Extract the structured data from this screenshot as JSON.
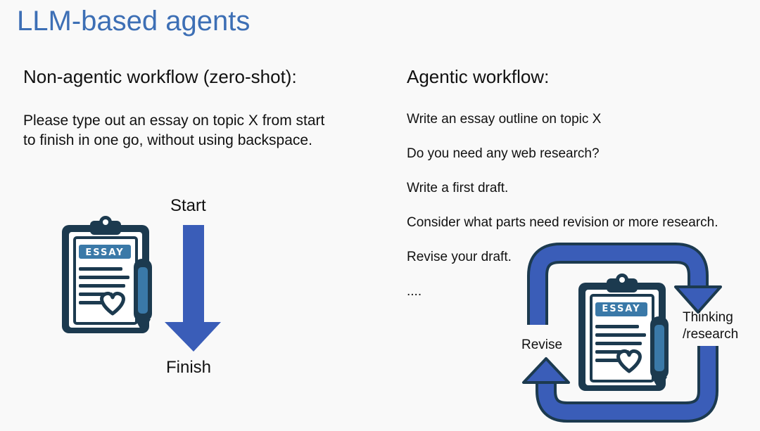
{
  "slide": {
    "title": "LLM-based agents"
  },
  "left": {
    "heading": "Non-agentic workflow (zero-shot):",
    "prompt": "Please type out an essay on topic X from start to finish in one go, without using backspace.",
    "start_label": "Start",
    "finish_label": "Finish",
    "clipboard_text": "ESSAY"
  },
  "right": {
    "heading": "Agentic workflow:",
    "steps": [
      "Write an essay outline on topic X",
      "Do you need any web research?",
      "Write a first draft.",
      "Consider what parts need revision or more research.",
      "Revise your draft.",
      "...."
    ],
    "revise_label": "Revise",
    "thinking_label_line1": "Thinking",
    "thinking_label_line2": "/research",
    "clipboard_text": "ESSAY"
  },
  "colors": {
    "title": "#3d6fb5",
    "arrow": "#3a5db8",
    "clipboard_dark": "#1c3a4f",
    "clipboard_accent": "#3a79a8",
    "clipboard_light": "#ffffff"
  },
  "icons": [
    "clipboard-icon",
    "pencil-icon",
    "heart-icon",
    "down-arrow-icon",
    "cycle-arrow-icon"
  ]
}
